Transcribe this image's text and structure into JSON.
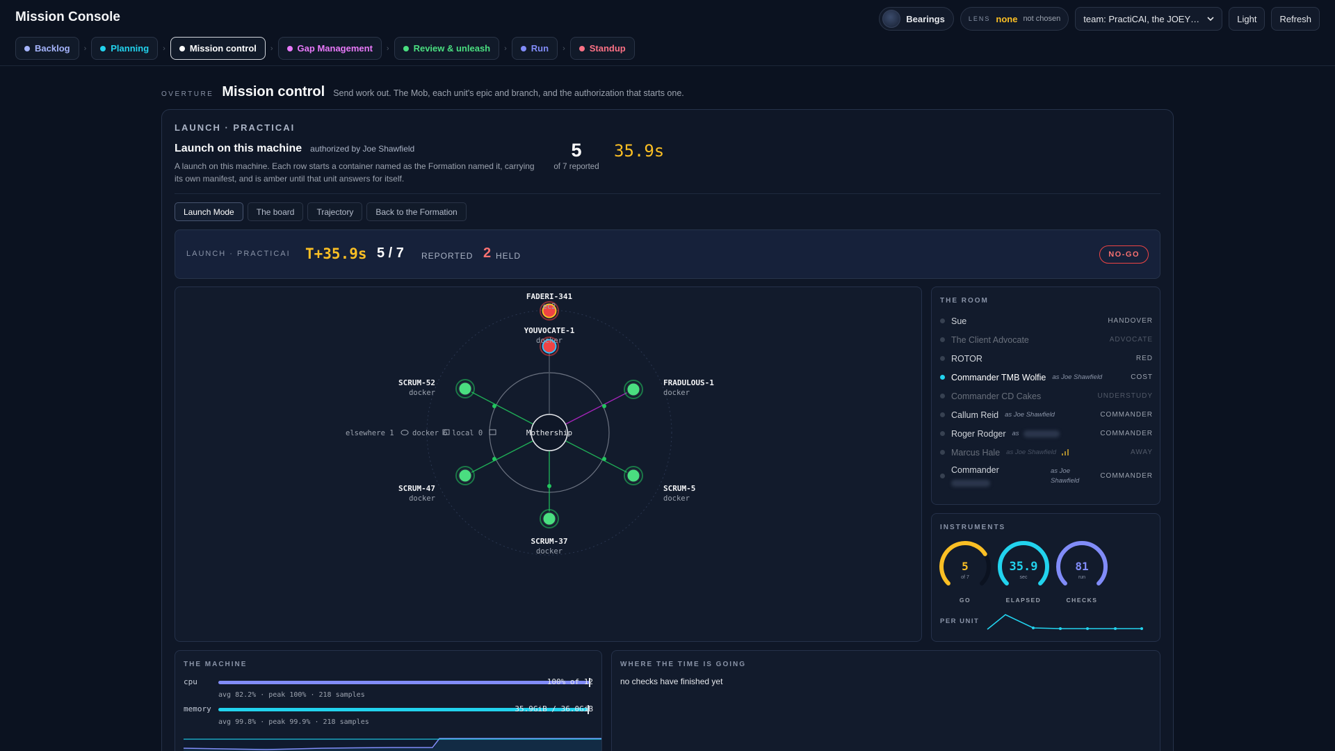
{
  "app": {
    "title": "Mission Console"
  },
  "top_right": {
    "bearings_label": "Bearings",
    "lens_label": "LENS",
    "lens_value": "none",
    "lens_sub": "not chosen",
    "team_value": "team: PractiCAI, the JOEY…",
    "theme_label": "Light",
    "refresh_label": "Refresh"
  },
  "stages": [
    {
      "label": "Backlog",
      "color": "#a5b4fc",
      "active": false
    },
    {
      "label": "Planning",
      "color": "#22d3ee",
      "active": false
    },
    {
      "label": "Mission control",
      "color": "#ffffff",
      "active": true
    },
    {
      "label": "Gap Management",
      "color": "#e879f9",
      "active": false
    },
    {
      "label": "Review & unleash",
      "color": "#4ade80",
      "active": false
    },
    {
      "label": "Run",
      "color": "#818cf8",
      "active": false
    },
    {
      "label": "Standup",
      "color": "#fb7185",
      "active": false
    }
  ],
  "overture": {
    "tag": "OVERTURE",
    "title": "Mission control",
    "desc": "Send work out. The Mob, each unit's epic and branch, and the authorization that starts one."
  },
  "launch": {
    "tag": "LAUNCH · PRACTICAI",
    "title": "Launch on this machine",
    "authorized": "authorized by Joe Shawfield",
    "desc": "A launch on this machine. Each row starts a container named as the Formation named it, carrying its own manifest, and is amber until that unit answers for itself.",
    "count": "5",
    "count_sub": "of 7 reported",
    "elapsed": "35.9s"
  },
  "tabs": [
    {
      "label": "Launch Mode",
      "active": true
    },
    {
      "label": "The board",
      "active": false
    },
    {
      "label": "Trajectory",
      "active": false
    },
    {
      "label": "Back to the Formation",
      "active": false
    }
  ],
  "status": {
    "tag": "LAUNCH · PRACTICAI",
    "tplus": "T+35.9s",
    "reported": "5 / 7",
    "reported_label": "REPORTED",
    "held": "2",
    "held_label": "HELD",
    "verdict": "NO-GO"
  },
  "radar": {
    "center": "Mothership",
    "legend": "elsewhere 1 ☁ docker 6 ▭ local 0 ▭",
    "legend_parts": [
      {
        "label": "elsewhere 1"
      },
      {
        "label": "docker 6"
      },
      {
        "label": "local 0"
      }
    ],
    "units": [
      {
        "name": "FADERI-341",
        "type": "ec2",
        "status": "held",
        "color": "#ef4444"
      },
      {
        "name": "YOUVOCATE-1",
        "type": "docker",
        "status": "held",
        "color": "#ef4444"
      },
      {
        "name": "FRADULOUS-1",
        "type": "docker",
        "status": "go",
        "color": "#4ade80"
      },
      {
        "name": "SCRUM-5",
        "type": "docker",
        "status": "go",
        "color": "#4ade80"
      },
      {
        "name": "SCRUM-37",
        "type": "docker",
        "status": "go",
        "color": "#4ade80"
      },
      {
        "name": "SCRUM-47",
        "type": "docker",
        "status": "go",
        "color": "#4ade80"
      },
      {
        "name": "SCRUM-52",
        "type": "docker",
        "status": "go",
        "color": "#4ade80"
      }
    ]
  },
  "room": {
    "title": "THE ROOM",
    "members": [
      {
        "name": "Sue",
        "as": "",
        "role": "HANDOVER",
        "state": "normal"
      },
      {
        "name": "The Client Advocate",
        "as": "",
        "role": "ADVOCATE",
        "state": "dim"
      },
      {
        "name": "ROTOR",
        "as": "",
        "role": "RED",
        "state": "normal"
      },
      {
        "name": "Commander TMB Wolfie",
        "as": "as Joe Shawfield",
        "role": "COST",
        "state": "highlight"
      },
      {
        "name": "Commander CD Cakes",
        "as": "",
        "role": "UNDERSTUDY",
        "state": "dim"
      },
      {
        "name": "Callum Reid",
        "as": "as Joe Shawfield",
        "role": "COMMANDER",
        "state": "normal"
      },
      {
        "name": "Roger Rodger",
        "as": "as",
        "role": "COMMANDER",
        "state": "normal"
      },
      {
        "name": "Marcus Hale",
        "as": "as Joe Shawfield",
        "role": "AWAY",
        "state": "dim"
      },
      {
        "name": "Commander",
        "as": "as Joe Shawfield",
        "role": "COMMANDER",
        "state": "normal"
      }
    ]
  },
  "instruments": {
    "title": "INSTRUMENTS",
    "gauges": [
      {
        "value": "5",
        "sub": "of 7",
        "label": "GO",
        "color": "#fbbf24",
        "fraction": 0.714
      },
      {
        "value": "35.9",
        "sub": "sec",
        "label": "ELAPSED",
        "color": "#22d3ee",
        "fraction": 1.0
      },
      {
        "value": "81",
        "sub": "run",
        "label": "CHECKS",
        "color": "#818cf8",
        "fraction": 1.0
      }
    ],
    "per_unit_label": "PER UNIT"
  },
  "machine": {
    "title": "THE MACHINE",
    "cpu": {
      "label": "cpu",
      "value": "100% of 12",
      "fraction": 1.0,
      "sub": "avg 82.2% · peak 100% · 218 samples",
      "color": "#818cf8"
    },
    "memory": {
      "label": "memory",
      "value": "35.9GiB / 36.0GiB",
      "fraction": 0.997,
      "sub": "avg 99.8% · peak 99.9% · 218 samples",
      "color": "#22d3ee"
    }
  },
  "time": {
    "title": "WHERE THE TIME IS GOING",
    "message": "no checks have finished yet"
  }
}
